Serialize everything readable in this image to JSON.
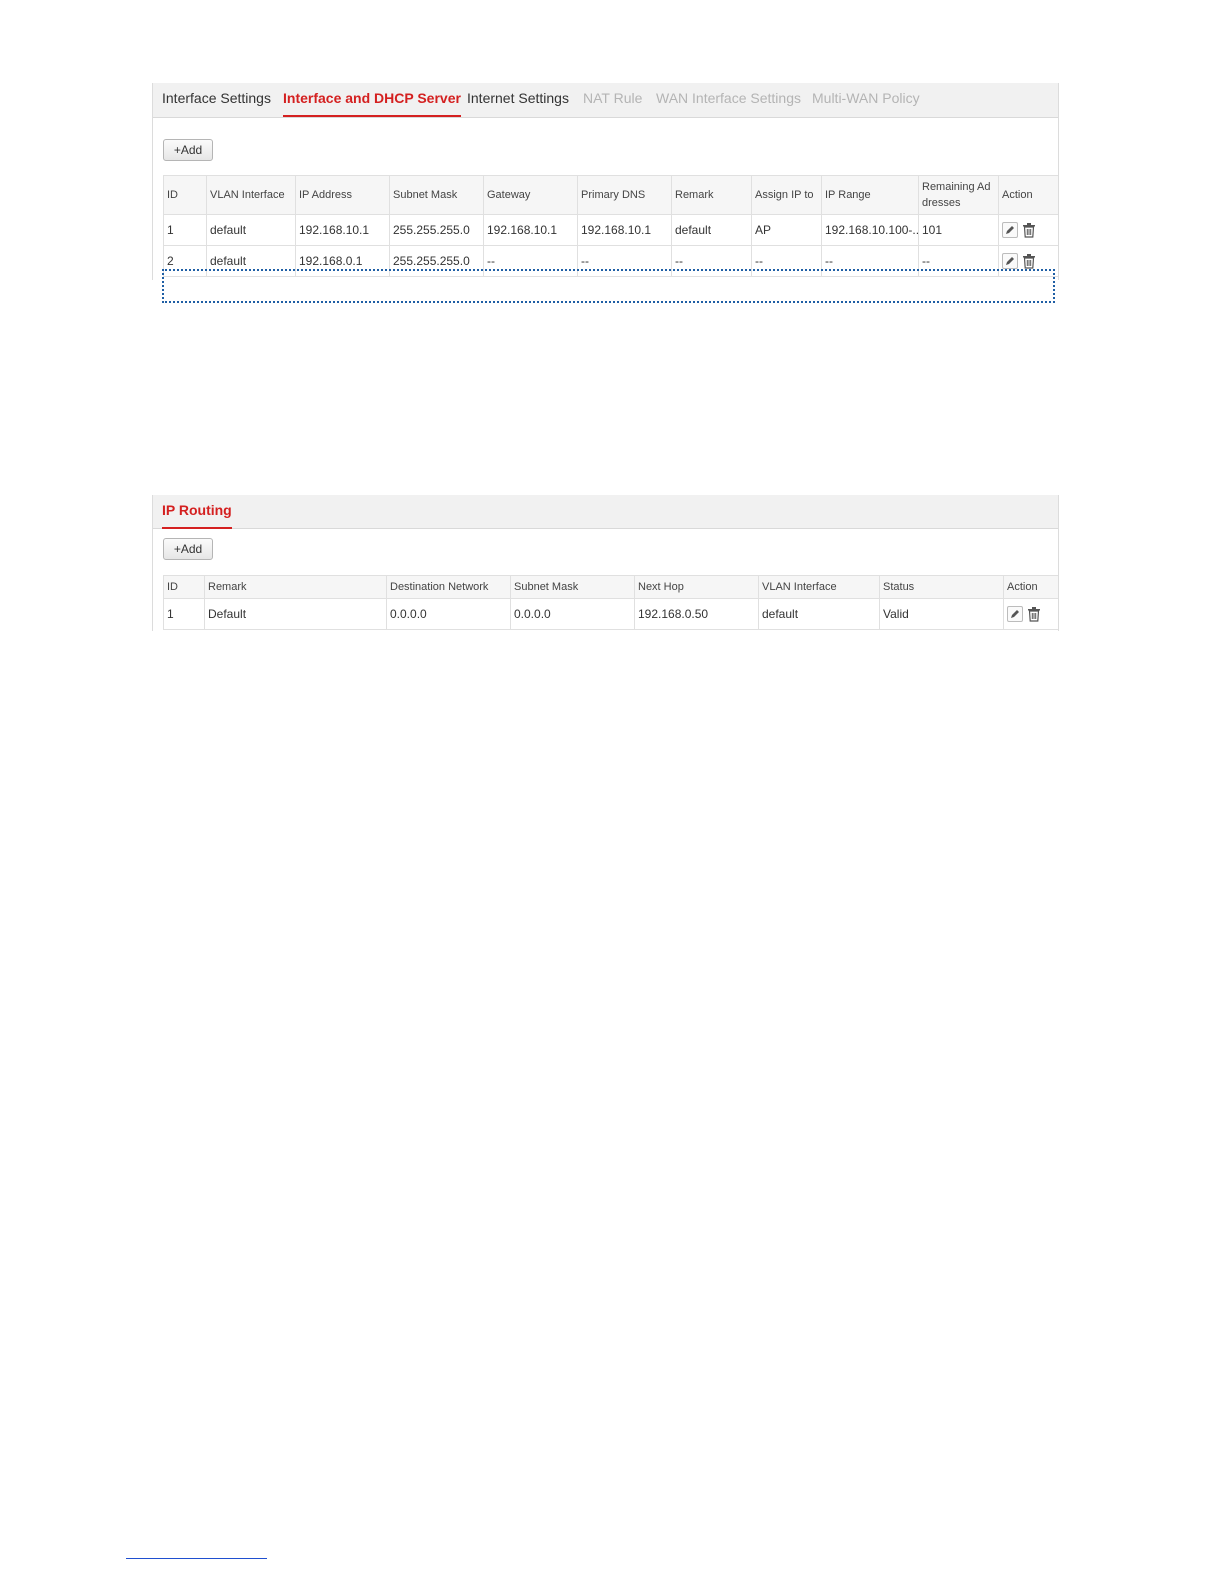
{
  "interface_panel": {
    "tabs": [
      {
        "label": "Interface Settings",
        "state": "normal"
      },
      {
        "label": "Interface and DHCP Server",
        "state": "active"
      },
      {
        "label": "Internet Settings",
        "state": "normal"
      },
      {
        "label": "NAT Rule",
        "state": "disabled"
      },
      {
        "label": "WAN Interface Settings",
        "state": "disabled"
      },
      {
        "label": "Multi-WAN Policy",
        "state": "disabled"
      }
    ],
    "add_label": "+Add",
    "columns": [
      "ID",
      "VLAN Interface",
      "IP Address",
      "Subnet Mask",
      "Gateway",
      "Primary DNS",
      "Remark",
      "Assign IP to",
      "IP Range",
      "Remaining Ad dresses",
      "Action"
    ],
    "rows": [
      [
        "1",
        "default",
        "192.168.10.1",
        "255.255.255.0",
        "192.168.10.1",
        "192.168.10.1",
        "default",
        "AP",
        "192.168.10.100-...",
        "101"
      ],
      [
        "2",
        "default",
        "192.168.0.1",
        "255.255.255.0",
        "--",
        "--",
        "--",
        "--",
        "--",
        "--"
      ]
    ]
  },
  "routing_panel": {
    "title": "IP Routing",
    "add_label": "+Add",
    "columns": [
      "ID",
      "Remark",
      "Destination Network",
      "Subnet Mask",
      "Next Hop",
      "VLAN Interface",
      "Status",
      "Action"
    ],
    "rows": [
      [
        "1",
        "Default",
        "0.0.0.0",
        "0.0.0.0",
        "192.168.0.50",
        "default",
        "Valid"
      ]
    ]
  },
  "colors": {
    "accent": "#d42020",
    "disabled_tab": "#b4b4b4",
    "highlight_box": "#1f5fa5",
    "link": "#1f4fd0"
  },
  "icons": [
    "edit-pencil-icon",
    "trash-icon"
  ]
}
